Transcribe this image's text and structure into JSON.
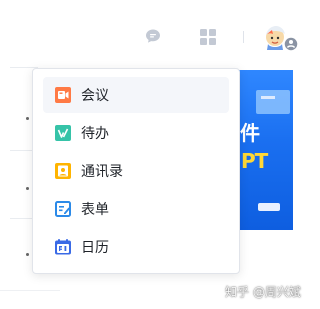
{
  "topbar": {
    "icons": {
      "chat": "chat-bubble-icon",
      "apps": "app-grid-icon",
      "avatar": "user-avatar-icon"
    },
    "colors": {
      "icon": "#c2c8d3"
    }
  },
  "menu": {
    "items": [
      {
        "label": "会议",
        "icon": "meeting-icon",
        "color": "#ff7a45"
      },
      {
        "label": "待办",
        "icon": "todo-icon",
        "color": "#36c3a8"
      },
      {
        "label": "通讯录",
        "icon": "contacts-icon",
        "color": "#ffb400"
      },
      {
        "label": "表单",
        "icon": "form-icon",
        "color": "#2b8ae8"
      },
      {
        "label": "日历",
        "icon": "calendar-icon",
        "color": "#3a6ae6"
      }
    ]
  },
  "banner": {
    "line1": "件",
    "line2": "PT",
    "background": "#1f75f5",
    "accent": "#ffd836"
  },
  "watermark": "知乎 @周兴斌"
}
